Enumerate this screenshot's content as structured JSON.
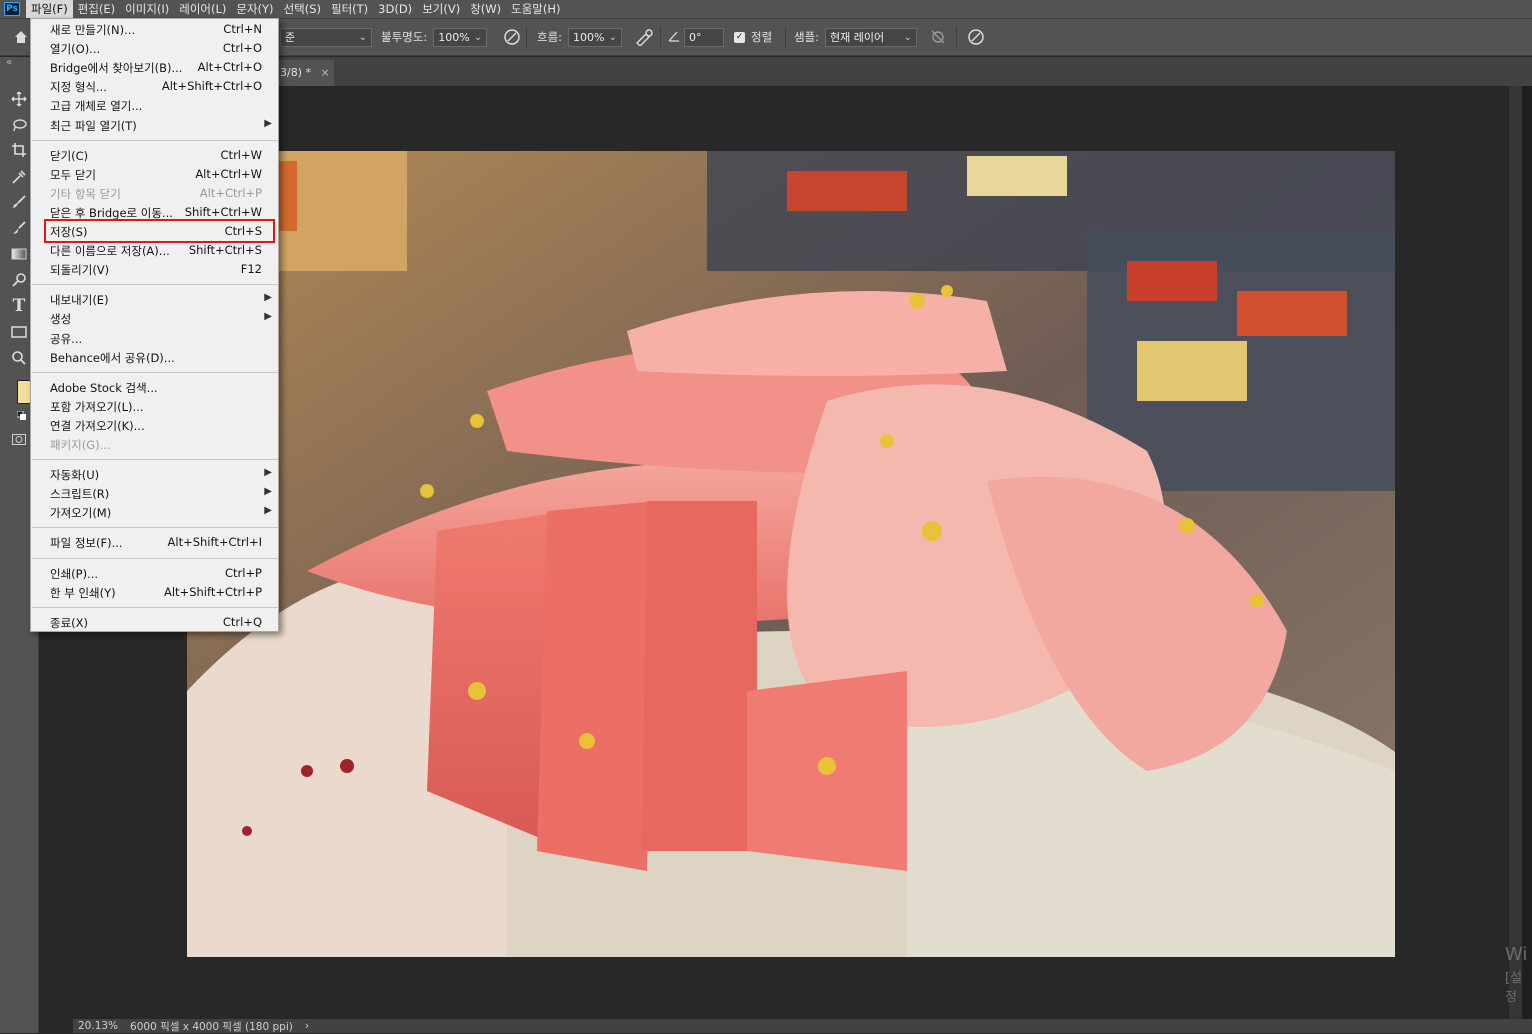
{
  "app": {
    "logo_text": "Ps"
  },
  "menubar": {
    "items": [
      "파일(F)",
      "편집(E)",
      "이미지(I)",
      "레이어(L)",
      "문자(Y)",
      "선택(S)",
      "필터(T)",
      "3D(D)",
      "보기(V)",
      "창(W)",
      "도움말(H)"
    ]
  },
  "optionsbar": {
    "mode_partial": "준",
    "opacity_label": "불투명도:",
    "opacity_value": "100%",
    "flow_label": "흐름:",
    "flow_value": "100%",
    "angle_value": "0°",
    "align_label": "정렬",
    "sample_label": "샘플:",
    "sample_value": "현재 레이어"
  },
  "document": {
    "tab_label": "3/8) *",
    "tab_close": "×"
  },
  "file_menu": {
    "groups": [
      [
        {
          "label": "새로 만들기(N)...",
          "shortcut": "Ctrl+N"
        },
        {
          "label": "열기(O)...",
          "shortcut": "Ctrl+O"
        },
        {
          "label": "Bridge에서 찾아보기(B)...",
          "shortcut": "Alt+Ctrl+O"
        },
        {
          "label": "지정 형식...",
          "shortcut": "Alt+Shift+Ctrl+O"
        },
        {
          "label": "고급 개체로 열기...",
          "shortcut": ""
        },
        {
          "label": "최근 파일 열기(T)",
          "shortcut": "",
          "submenu": true
        }
      ],
      [
        {
          "label": "닫기(C)",
          "shortcut": "Ctrl+W"
        },
        {
          "label": "모두 닫기",
          "shortcut": "Alt+Ctrl+W"
        },
        {
          "label": "기타 항목 닫기",
          "shortcut": "Alt+Ctrl+P",
          "disabled": true
        },
        {
          "label": "닫은 후 Bridge로 이동...",
          "shortcut": "Shift+Ctrl+W"
        },
        {
          "label": "저장(S)",
          "shortcut": "Ctrl+S"
        },
        {
          "label": "다른 이름으로 저장(A)...",
          "shortcut": "Shift+Ctrl+S"
        },
        {
          "label": "되돌리기(V)",
          "shortcut": "F12"
        }
      ],
      [
        {
          "label": "내보내기(E)",
          "shortcut": "",
          "submenu": true
        },
        {
          "label": "생성",
          "shortcut": "",
          "submenu": true
        },
        {
          "label": "공유...",
          "shortcut": ""
        },
        {
          "label": "Behance에서 공유(D)...",
          "shortcut": ""
        }
      ],
      [
        {
          "label": "Adobe Stock 검색...",
          "shortcut": ""
        },
        {
          "label": "포함 가져오기(L)...",
          "shortcut": ""
        },
        {
          "label": "연결 가져오기(K)...",
          "shortcut": ""
        },
        {
          "label": "패키지(G)...",
          "shortcut": "",
          "disabled": true
        }
      ],
      [
        {
          "label": "자동화(U)",
          "shortcut": "",
          "submenu": true
        },
        {
          "label": "스크립트(R)",
          "shortcut": "",
          "submenu": true
        },
        {
          "label": "가져오기(M)",
          "shortcut": "",
          "submenu": true
        }
      ],
      [
        {
          "label": "파일 정보(F)...",
          "shortcut": "Alt+Shift+Ctrl+I"
        }
      ],
      [
        {
          "label": "인쇄(P)...",
          "shortcut": "Ctrl+P"
        },
        {
          "label": "한 부 인쇄(Y)",
          "shortcut": "Alt+Shift+Ctrl+P"
        }
      ],
      [
        {
          "label": "종료(X)",
          "shortcut": "Ctrl+Q"
        }
      ]
    ],
    "highlighted_item": "저장(S)"
  },
  "status": {
    "zoom": "20.13%",
    "dimensions": "6000 픽셀 x 4000 픽셀 (180 ppi)",
    "arrow": "›"
  },
  "watermark": {
    "line1": "Wi",
    "line2": "[설정"
  },
  "colors": {
    "menubar_bg": "#535353",
    "canvas_bg": "#282828",
    "menu_bg": "#f0f0f0",
    "highlight_border": "#e01818",
    "foreground_swatch": "#f3dea0"
  },
  "icons": [
    "move-icon",
    "lasso-icon",
    "crop-icon",
    "eyedropper-icon",
    "brush-icon",
    "clone-stamp-icon",
    "gradient-icon",
    "pen-icon",
    "type-icon",
    "rectangle-icon",
    "zoom-icon"
  ]
}
